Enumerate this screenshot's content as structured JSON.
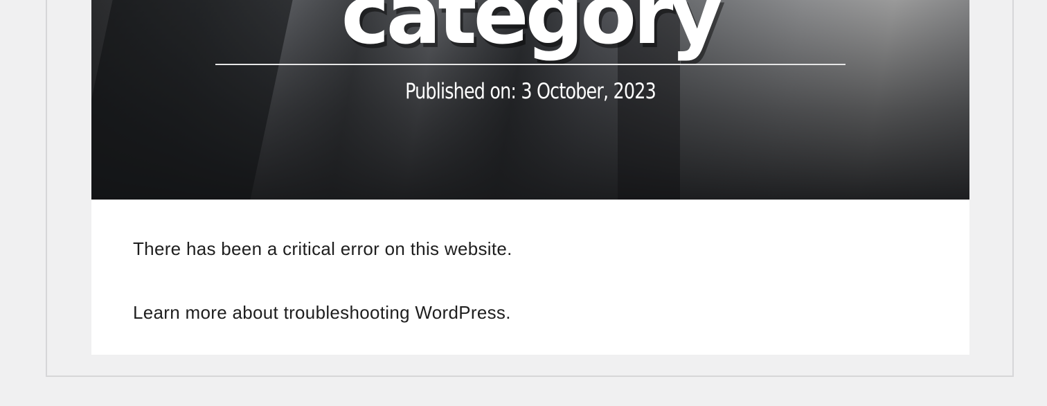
{
  "hero": {
    "title": "category",
    "published_label": "Published on:",
    "published_date": "3 October, 2023"
  },
  "error": {
    "message": "There has been a critical error on this website.",
    "help_link": "Learn more about troubleshooting WordPress."
  },
  "colors": {
    "page_background": "#f0f0f1",
    "content_background": "#ffffff",
    "text": "#1e1e1e",
    "hero_text": "#ffffff"
  }
}
